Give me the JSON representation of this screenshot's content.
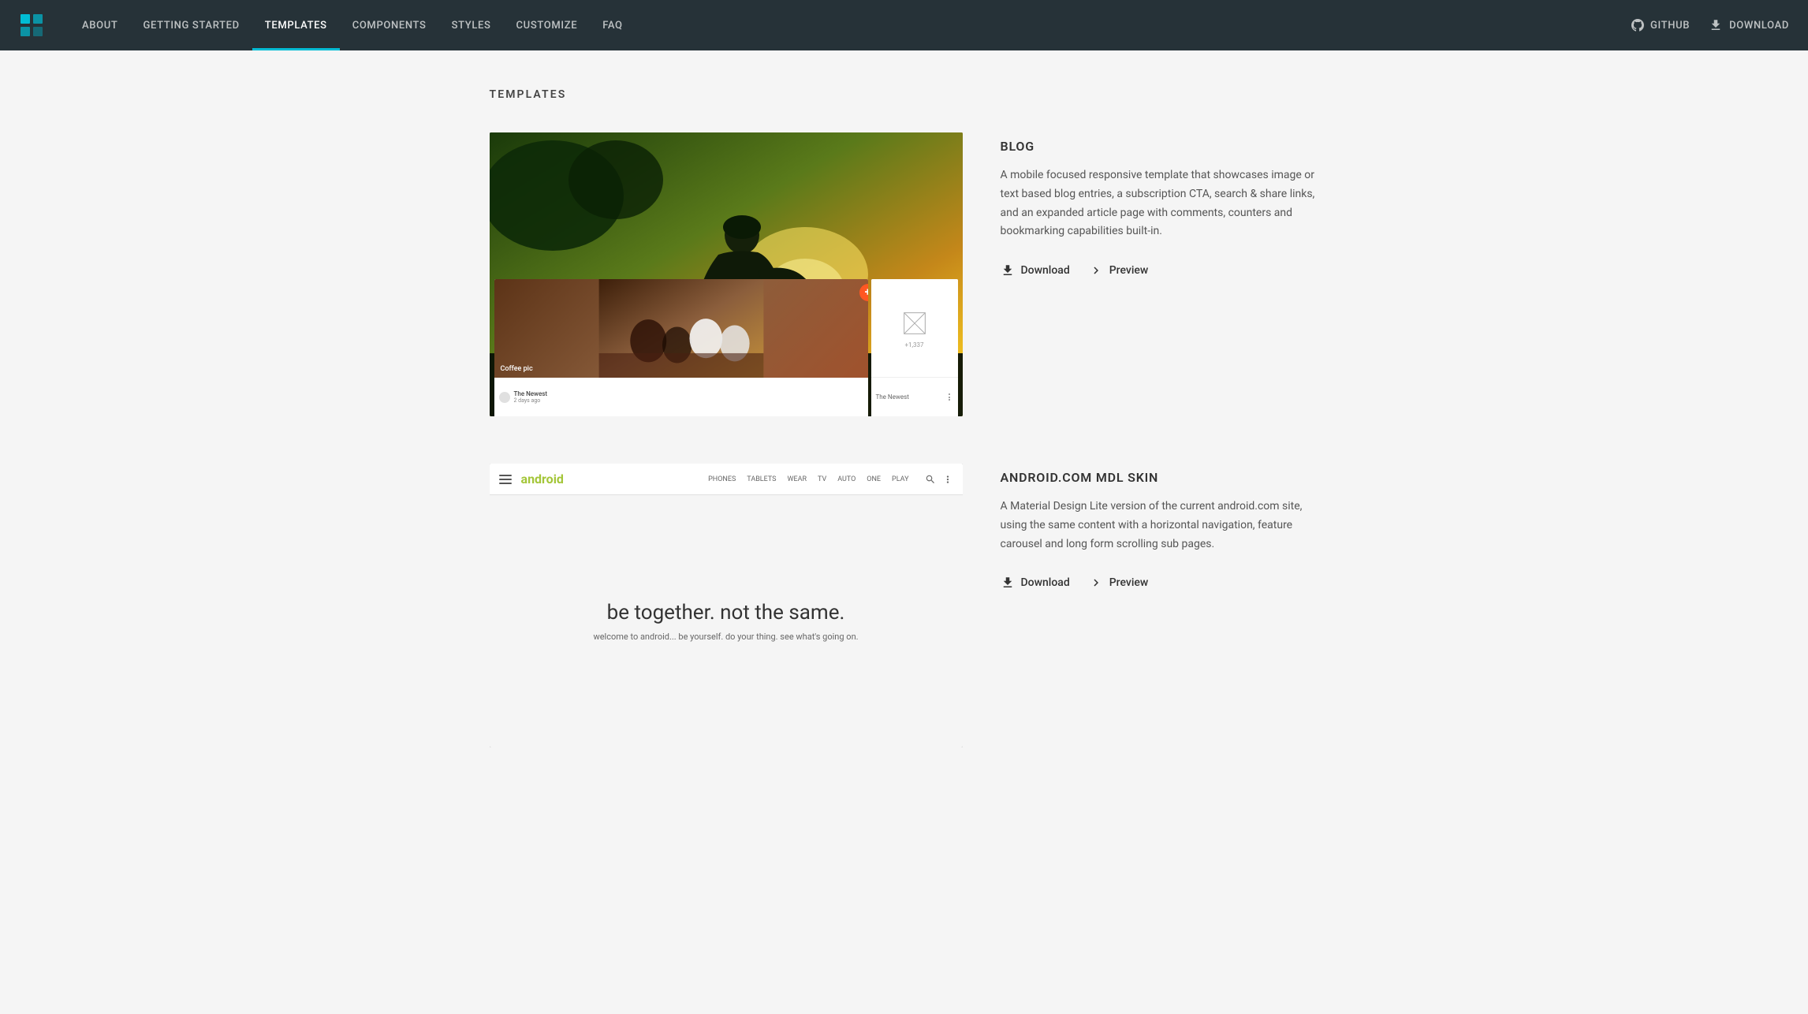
{
  "nav": {
    "logo_alt": "MDL Logo",
    "links": [
      {
        "label": "ABOUT",
        "active": false,
        "id": "about"
      },
      {
        "label": "GETTING STARTED",
        "active": false,
        "id": "getting-started"
      },
      {
        "label": "TEMPLATES",
        "active": true,
        "id": "templates"
      },
      {
        "label": "COMPONENTS",
        "active": false,
        "id": "components"
      },
      {
        "label": "STYLES",
        "active": false,
        "id": "styles"
      },
      {
        "label": "CUSTOMIZE",
        "active": false,
        "id": "customize"
      },
      {
        "label": "FAQ",
        "active": false,
        "id": "faq"
      }
    ],
    "github_label": "GitHub",
    "download_label": "Download"
  },
  "page": {
    "title": "TEMPLATES"
  },
  "templates": [
    {
      "id": "blog",
      "name": "BLOG",
      "description": "A mobile focused responsive template that showcases image or text based blog entries, a subscription CTA, search & share links, and an expanded article page with comments, counters and bookmarking capabilities built-in.",
      "download_label": "Download",
      "preview_label": "Preview",
      "image_type": "blog",
      "coffee_label": "Coffee pic",
      "count_label": "+1,337",
      "newest_label": "The Newest",
      "days_ago": "2 days ago"
    },
    {
      "id": "android",
      "name": "ANDROID.COM MDL SKIN",
      "description": "A Material Design Lite version of the current android.com site, using the same content with a horizontal navigation, feature carousel and long form scrolling sub pages.",
      "download_label": "Download",
      "preview_label": "Preview",
      "image_type": "android",
      "android_headline": "be together. not the same.",
      "android_subtext": "welcome to android... be yourself. do your thing. see what's going on.",
      "nav_items": [
        "PHONES",
        "TABLETS",
        "WEAR",
        "TV",
        "AUTO",
        "ONE",
        "PLAY"
      ]
    }
  ]
}
